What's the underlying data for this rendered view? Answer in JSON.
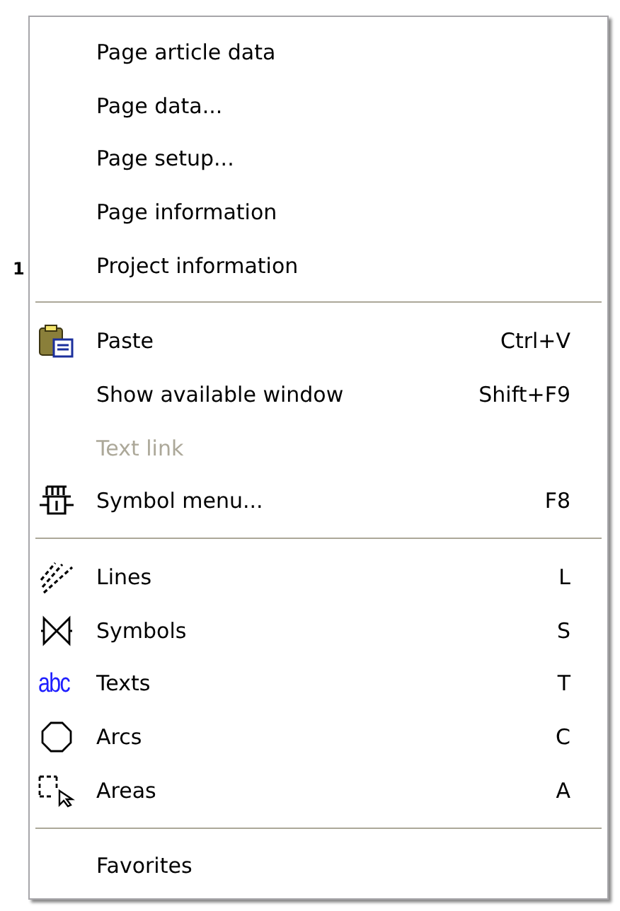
{
  "canvas": {
    "label": "1"
  },
  "menu": {
    "sections": [
      {
        "items": [
          {
            "label": "Page article data",
            "disabled": false
          },
          {
            "label": "Page data...",
            "disabled": false
          },
          {
            "label": "Page setup...",
            "disabled": false
          },
          {
            "label": "Page information",
            "disabled": false
          },
          {
            "label": "Project information",
            "disabled": false
          }
        ]
      },
      {
        "items": [
          {
            "label": "Paste",
            "shortcut": "Ctrl+V",
            "disabled": false
          },
          {
            "label": "Show available window",
            "shortcut": "Shift+F9",
            "disabled": false
          },
          {
            "label": "Text link",
            "disabled": true
          },
          {
            "label": "Symbol menu...",
            "shortcut": "F8",
            "disabled": false
          }
        ]
      },
      {
        "items": [
          {
            "label": "Lines",
            "shortcut": "L",
            "disabled": false
          },
          {
            "label": "Symbols",
            "shortcut": "S",
            "disabled": false
          },
          {
            "label": "Texts",
            "shortcut": "T",
            "icon_text": "abc",
            "disabled": false
          },
          {
            "label": "Arcs",
            "shortcut": "C",
            "disabled": false
          },
          {
            "label": "Areas",
            "shortcut": "A",
            "disabled": false
          }
        ]
      },
      {
        "items": [
          {
            "label": "Favorites",
            "disabled": false
          }
        ]
      }
    ]
  }
}
